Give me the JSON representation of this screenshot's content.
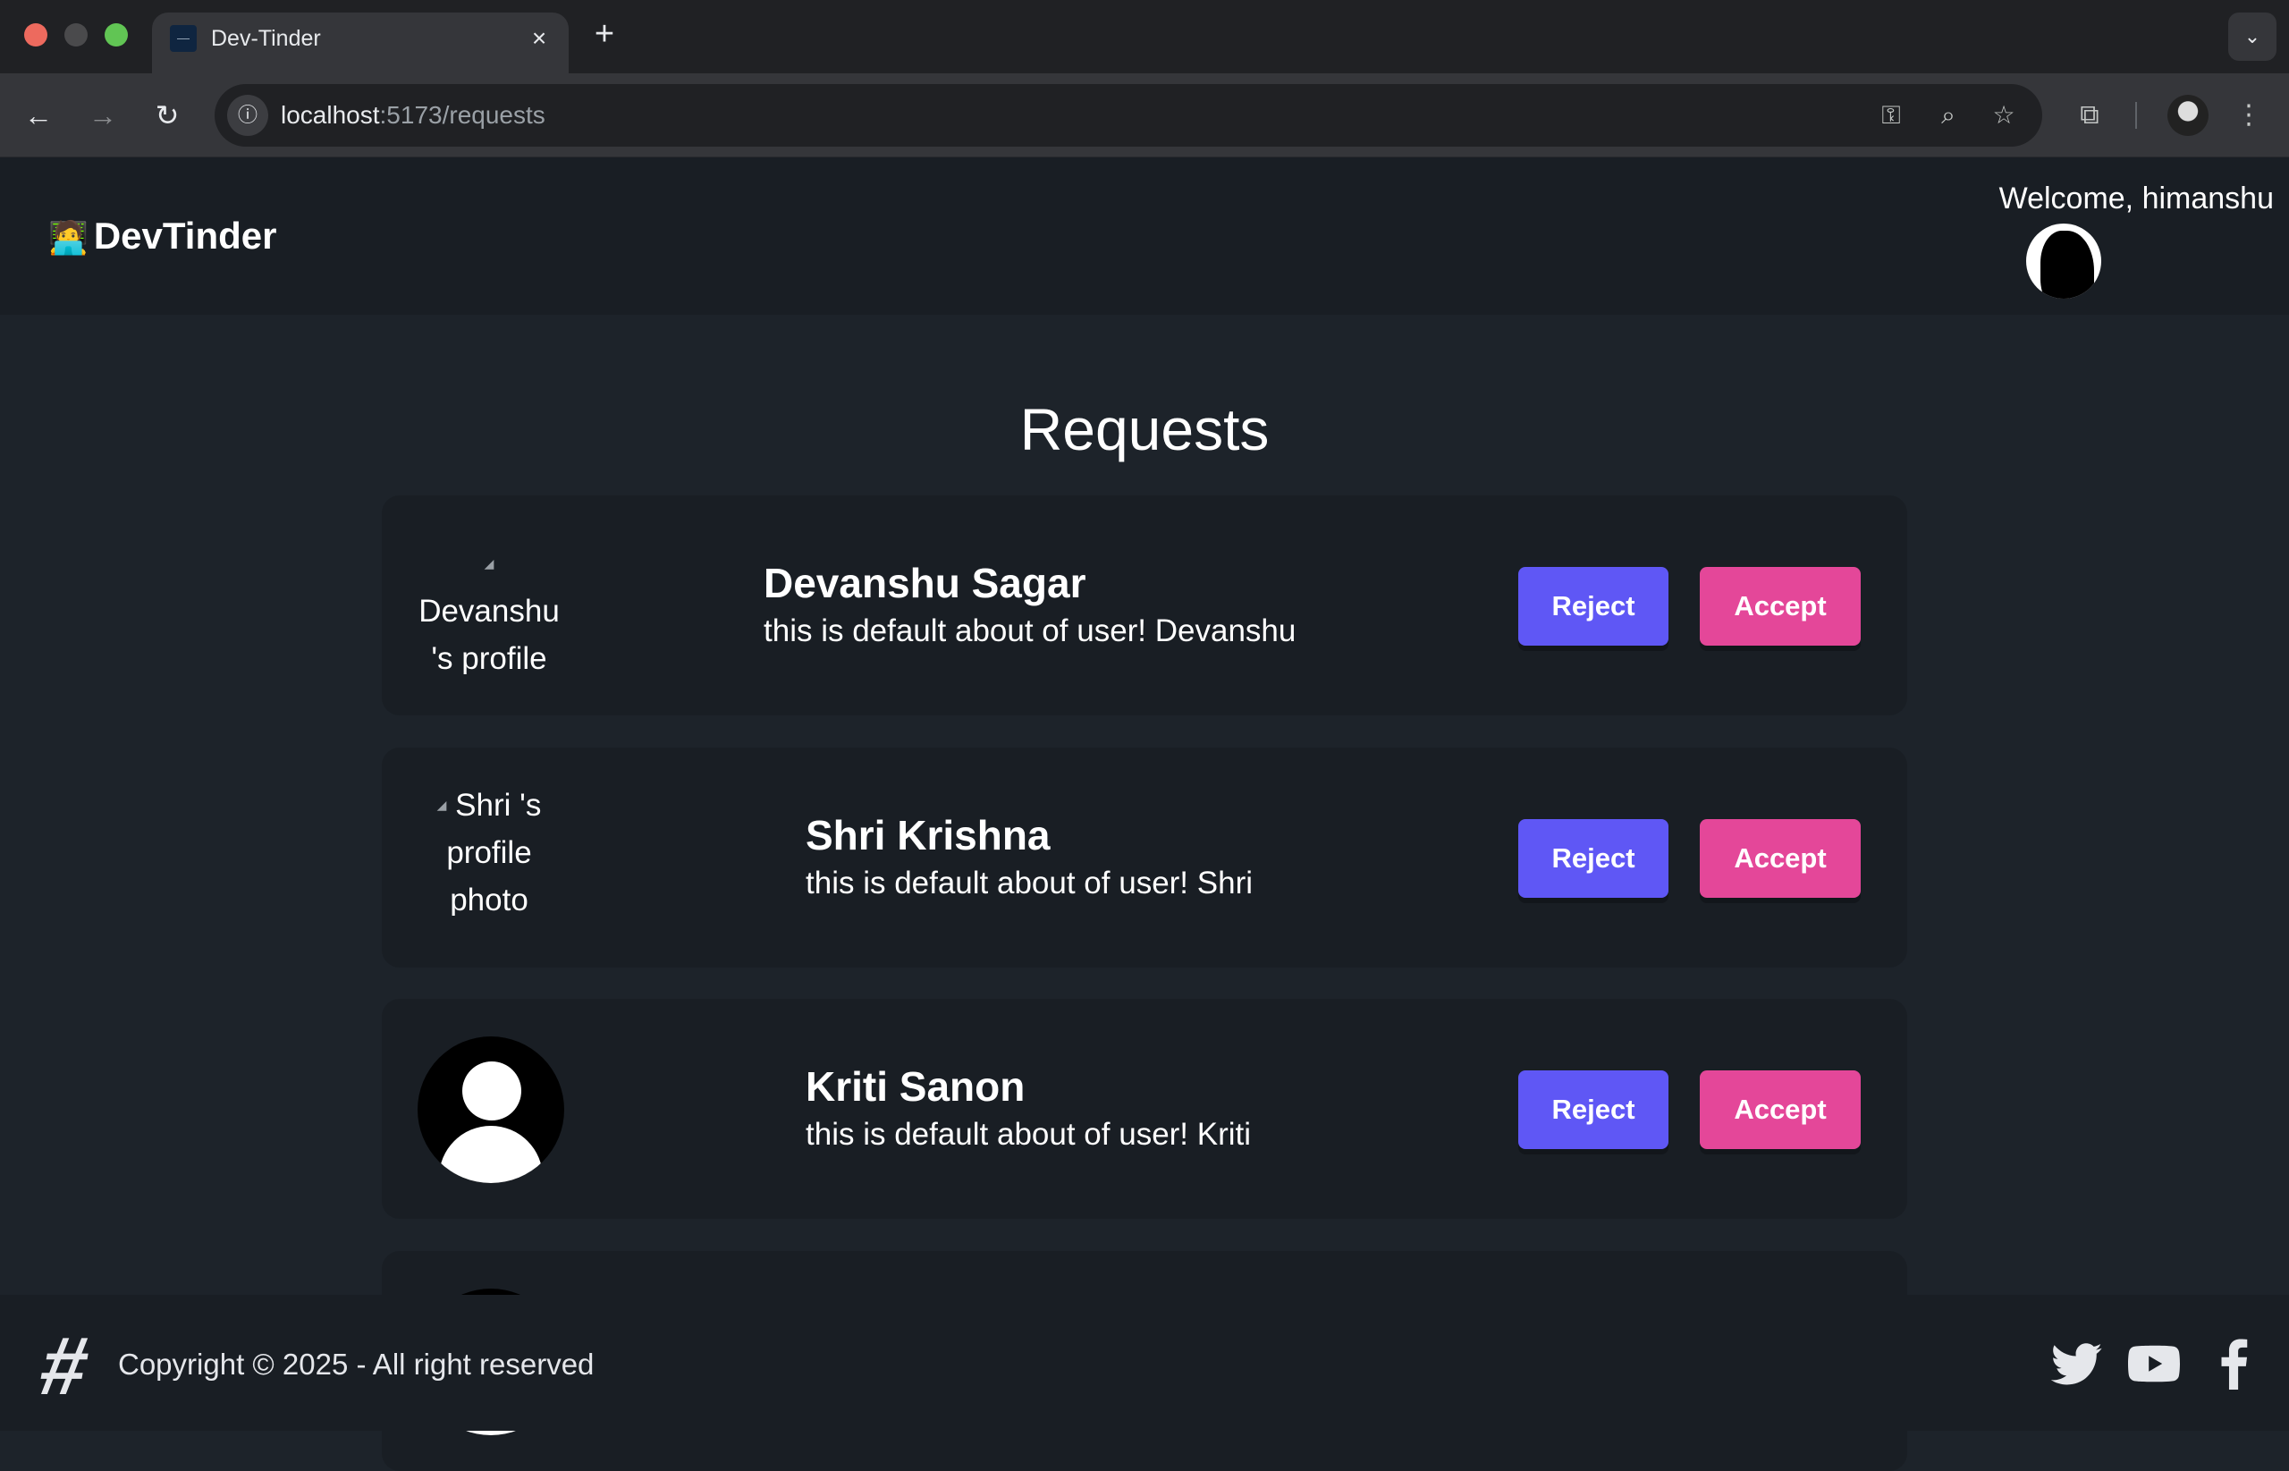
{
  "browser": {
    "tab_title": "Dev-Tinder",
    "url_host": "localhost",
    "url_path": ":5173/requests"
  },
  "navbar": {
    "brand_emoji": "🧑‍💻",
    "brand": "DevTinder",
    "welcome": "Welcome, himanshu"
  },
  "page": {
    "title": "Requests"
  },
  "requests": [
    {
      "name": "Devanshu Sagar",
      "about": "this is default about of user! Devanshu",
      "photo_alt": "Devanshu 's profile photo",
      "reject_label": "Reject",
      "accept_label": "Accept"
    },
    {
      "name": "Shri Krishna",
      "about": "this is default about of user! Shri",
      "photo_alt": "Shri 's profile photo",
      "reject_label": "Reject",
      "accept_label": "Accept"
    },
    {
      "name": "Kriti Sanon",
      "about": "this is default about of user! Kriti",
      "reject_label": "Reject",
      "accept_label": "Accept"
    }
  ],
  "footer": {
    "copyright": "Copyright © 2025 - All right reserved"
  },
  "colors": {
    "reject": "#5f57f5",
    "accept": "#e44799",
    "page_bg": "#1d232a",
    "card_bg": "#191e24"
  }
}
